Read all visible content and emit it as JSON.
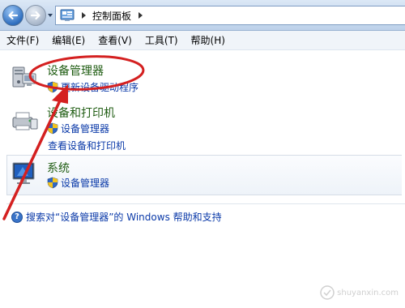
{
  "address_bar": {
    "breadcrumb": "控制面板"
  },
  "menu": {
    "items": [
      "文件(F)",
      "编辑(E)",
      "查看(V)",
      "工具(T)",
      "帮助(H)"
    ]
  },
  "results": [
    {
      "title": "设备管理器",
      "links": [
        "更新设备驱动程序"
      ]
    },
    {
      "title": "设备和打印机",
      "links": [
        "设备管理器",
        "查看设备和打印机"
      ]
    },
    {
      "title": "系统",
      "links": [
        "设备管理器"
      ]
    }
  ],
  "help": {
    "text": "搜索对“设备管理器”的 Windows 帮助和支持"
  },
  "watermark": {
    "text": "shuyanxin.com"
  },
  "colors": {
    "title_green": "#1f5c12",
    "link_blue": "#0a39a8",
    "annotation_red": "#d42020"
  }
}
